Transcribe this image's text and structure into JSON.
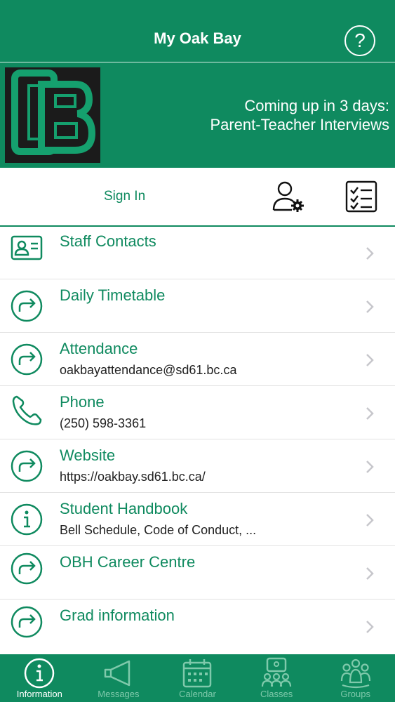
{
  "header": {
    "title": "My Oak Bay",
    "help_icon": "question-circle-icon"
  },
  "banner": {
    "logo_alt": "OB",
    "line1": "Coming up in 3 days:",
    "line2": "Parent-Teacher Interviews"
  },
  "actions": {
    "sign_in": "Sign In",
    "settings_icon": "user-settings-icon",
    "checklist_icon": "checklist-icon"
  },
  "list": [
    {
      "label": "Staff Contacts",
      "sub": "",
      "icon": "id-card-icon"
    },
    {
      "label": "Daily  Timetable",
      "sub": "",
      "icon": "redirect-arrow-icon"
    },
    {
      "label": "Attendance",
      "sub": "oakbayattendance@sd61.bc.ca",
      "icon": "redirect-arrow-icon"
    },
    {
      "label": "Phone",
      "sub": "(250) 598-3361",
      "icon": "phone-icon"
    },
    {
      "label": "Website",
      "sub": "https://oakbay.sd61.bc.ca/",
      "icon": "redirect-arrow-icon"
    },
    {
      "label": "Student Handbook",
      "sub": "Bell Schedule, Code of Conduct, ...",
      "icon": "info-circle-icon"
    },
    {
      "label": "OBH Career Centre",
      "sub": "",
      "icon": "redirect-arrow-icon"
    },
    {
      "label": "Grad information",
      "sub": "",
      "icon": "redirect-arrow-icon"
    }
  ],
  "tabs": [
    {
      "label": "Information",
      "icon": "info-circle-icon",
      "active": true
    },
    {
      "label": "Messages",
      "icon": "megaphone-icon",
      "active": false
    },
    {
      "label": "Calendar",
      "icon": "calendar-icon",
      "active": false
    },
    {
      "label": "Classes",
      "icon": "classroom-icon",
      "active": false
    },
    {
      "label": "Groups",
      "icon": "group-icon",
      "active": false
    }
  ],
  "colors": {
    "brand": "#0f8a5f",
    "text": "#222222",
    "divider": "#e2e2e2"
  }
}
